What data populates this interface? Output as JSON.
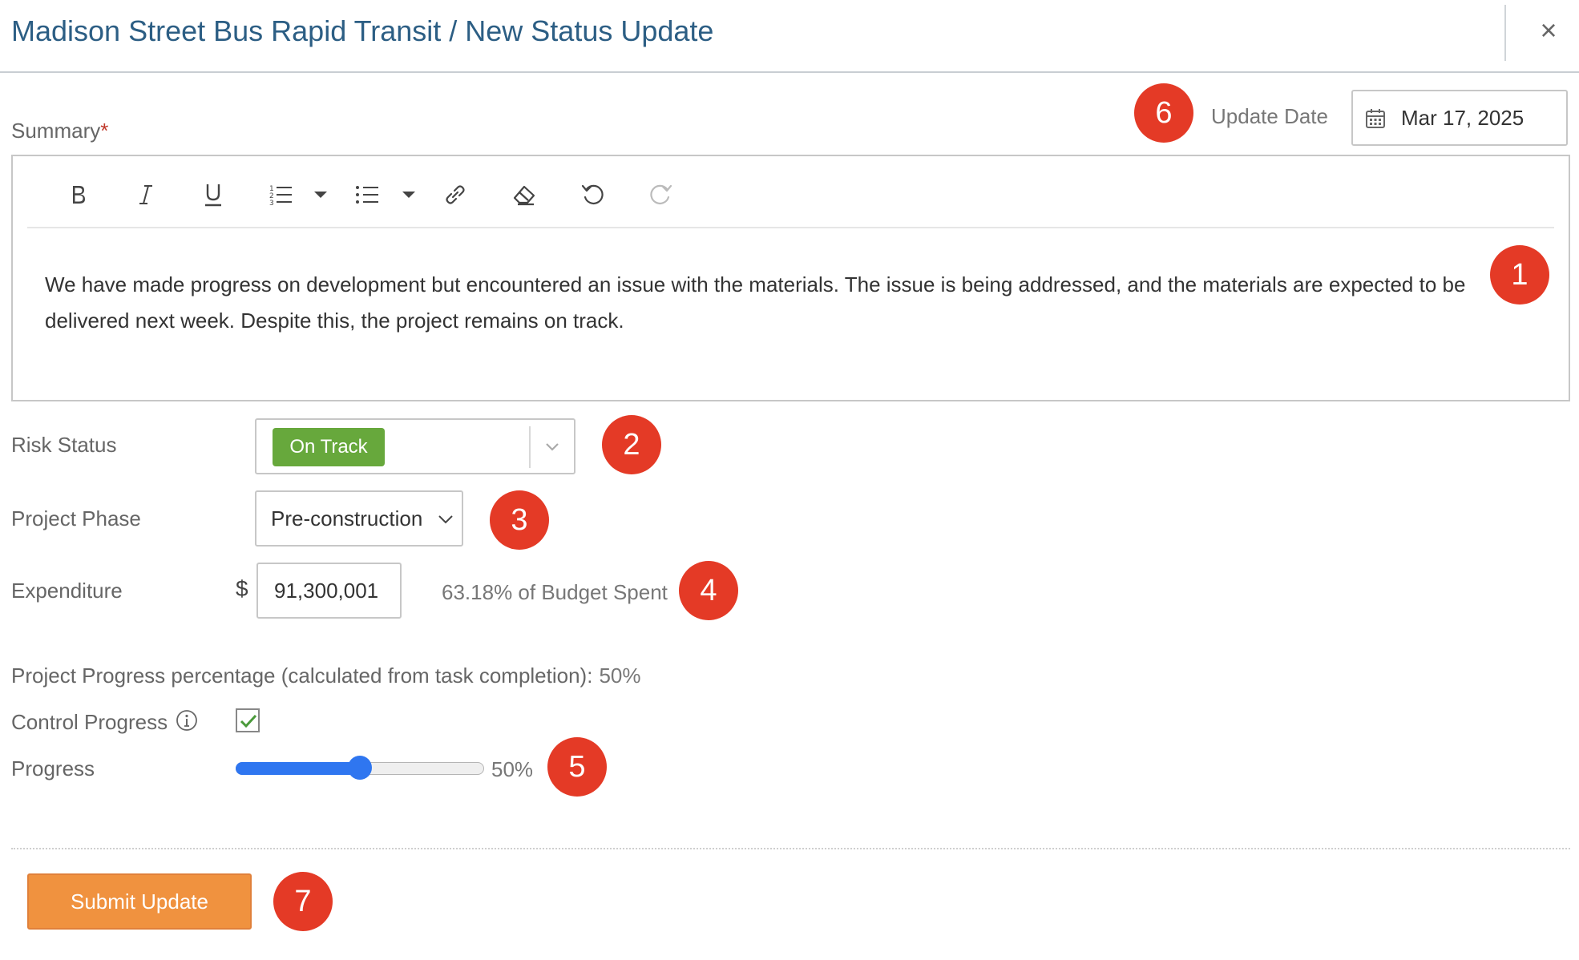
{
  "header": {
    "title": "Madison Street Bus Rapid Transit / New Status Update",
    "close_glyph": "×"
  },
  "summary": {
    "label": "Summary",
    "required_mark": "*",
    "text": "We have made progress on development but encountered an issue with the materials. The issue is being addressed, and the materials are expected to be delivered next week. Despite this, the project remains on track."
  },
  "toolbar": {
    "buttons": [
      "bold-icon",
      "italic-icon",
      "underline-icon",
      "ordered-list-icon",
      "unordered-list-icon",
      "link-icon",
      "eraser-icon",
      "undo-icon",
      "redo-icon"
    ]
  },
  "update_date": {
    "label": "Update Date",
    "value": "Mar 17, 2025"
  },
  "risk_status": {
    "label": "Risk Status",
    "value": "On Track",
    "badge_color": "#67a83c"
  },
  "project_phase": {
    "label": "Project Phase",
    "value": "Pre-construction"
  },
  "expenditure": {
    "label": "Expenditure",
    "currency": "$",
    "value": "91,300,001",
    "budget_text": "63.18% of Budget Spent"
  },
  "progress_calc": {
    "label": "Project Progress percentage (calculated from task completion):",
    "value": "50%"
  },
  "control_progress": {
    "label": "Control Progress",
    "checked": true
  },
  "progress": {
    "label": "Progress",
    "value": 50,
    "value_text": "50%"
  },
  "submit": {
    "label": "Submit Update",
    "color": "#f0923f"
  },
  "markers": [
    "1",
    "2",
    "3",
    "4",
    "5",
    "6",
    "7"
  ],
  "colors": {
    "title": "#2c5e84",
    "accent": "#2f76f0",
    "marker": "#e43a26"
  }
}
